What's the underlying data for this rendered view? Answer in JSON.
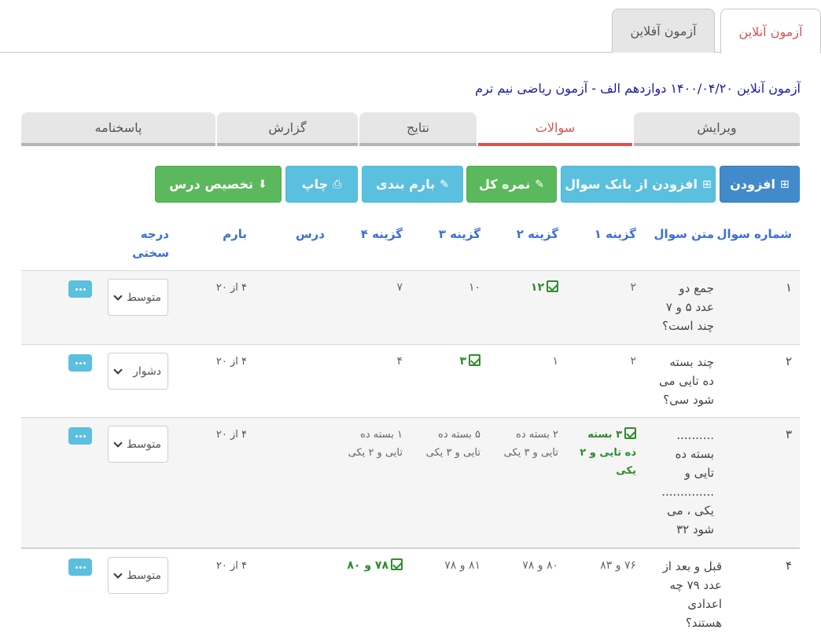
{
  "top_tabs": {
    "online": "آزمون آنلاین",
    "offline": "آزمون آفلاین"
  },
  "exam_title": "آزمون آنلاین ۱۴۰۰/۰۴/۲۰ دوازدهم الف - آزمون ریاضی نیم ترم",
  "sub_tabs": {
    "edit": "ویرایش",
    "questions": "سوالات",
    "results": "نتایج",
    "report": "گزارش",
    "answer_sheet": "پاسخنامه"
  },
  "toolbar": {
    "add": "افزودن",
    "add_from_bank": "افزودن از بانک سوال",
    "total_score": "نمره کل",
    "scoring": "بارم بندی",
    "print": "چاپ",
    "assign_lesson": "تخصیص درس"
  },
  "columns": {
    "number": "شماره سوال",
    "text": "متن سوال",
    "opt1": "گزینه ۱",
    "opt2": "گزینه ۲",
    "opt3": "گزینه ۳",
    "opt4": "گزینه ۴",
    "lesson": "درس",
    "score": "بارم",
    "difficulty_1": "درجه",
    "difficulty_2": "سختی"
  },
  "rows": [
    {
      "num": "۱",
      "text": [
        "جمع دو",
        "عدد ۵ و ۷",
        "چند است؟"
      ],
      "opt1": [
        "۲"
      ],
      "opt2": [
        "۱۲"
      ],
      "opt3": [
        "۱۰"
      ],
      "opt4": [
        "۷"
      ],
      "correct": 2,
      "score": "۴ از ۲۰",
      "difficulty": "متوسط"
    },
    {
      "num": "۲",
      "text": [
        "چند بسته",
        "ده تایی می",
        "شود سی؟"
      ],
      "opt1": [
        "۲"
      ],
      "opt2": [
        "۱"
      ],
      "opt3": [
        "۳"
      ],
      "opt4": [
        "۴"
      ],
      "correct": 3,
      "score": "۴ از ۲۰",
      "difficulty": "دشوار"
    },
    {
      "num": "۳",
      "text": [
        "..........",
        "بسته ده",
        "تایی و",
        "..............",
        "یکی ، می",
        "شود ۳۲"
      ],
      "opt1": [
        "۳ بسته",
        "ده تایی و ۲",
        "یکی"
      ],
      "opt2": [
        "۲ بسته ده",
        "تایی و ۳ یکی"
      ],
      "opt3": [
        "۵ بسته ده",
        "تایی و ۳ یکی"
      ],
      "opt4": [
        "۱ بسته ده",
        "تایی و ۲ یکی"
      ],
      "correct": 1,
      "score": "۴ از ۲۰",
      "difficulty": "متوسط"
    },
    {
      "num": "۴",
      "text": [
        "قبل و بعد از",
        "عدد ۷۹ چه",
        "اعدادی",
        "هستند؟"
      ],
      "opt1": [
        "۷۶ و ۸۳"
      ],
      "opt2": [
        "۸۰ و ۷۸"
      ],
      "opt3": [
        "۸۱ و ۷۸"
      ],
      "opt4": [
        "۷۸ و ۸۰"
      ],
      "correct": 4,
      "score": "۴ از ۲۰",
      "difficulty": "متوسط"
    }
  ]
}
